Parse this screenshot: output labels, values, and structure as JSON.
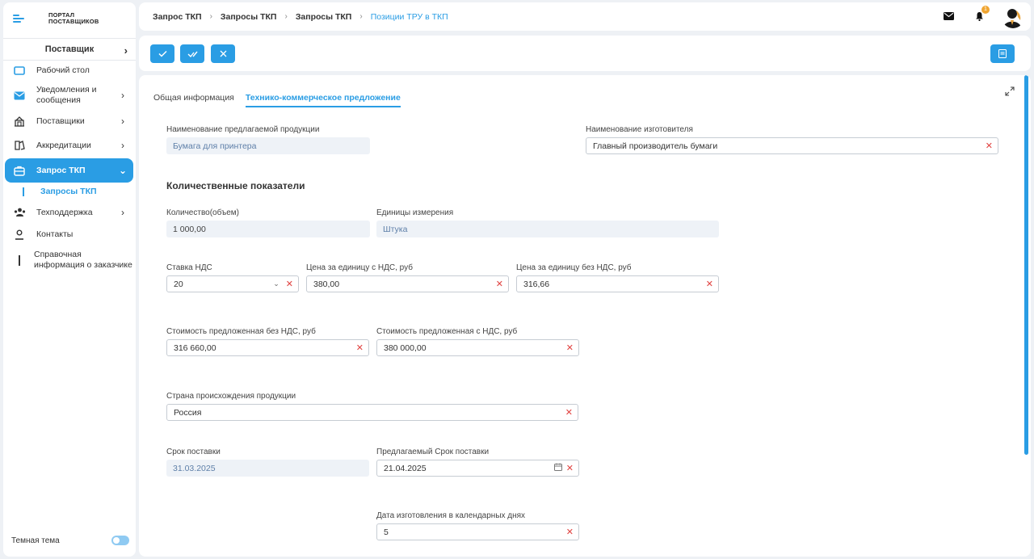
{
  "sidebar": {
    "logo": {
      "line1": "ПОРТАЛ",
      "line2": "ПОСТАВЩИКОВ"
    },
    "role": "Поставщик",
    "items": [
      {
        "label": "Рабочий стол"
      },
      {
        "label": "Уведомления и сообщения"
      },
      {
        "label": "Поставщики"
      },
      {
        "label": "Аккредитации"
      },
      {
        "label": "Запрос ТКП"
      },
      {
        "label": "Техподдержка"
      },
      {
        "label": "Контакты"
      },
      {
        "label": "Справочная информация о заказчике"
      }
    ],
    "subitem": "Запросы ТКП",
    "theme_label": "Темная тема"
  },
  "header": {
    "breadcrumbs": [
      "Запрос ТКП",
      "Запросы ТКП",
      "Запросы ТКП",
      "Позиции ТРУ в ТКП"
    ],
    "notifications_count": "1"
  },
  "tabs": [
    "Общая информация",
    "Технико-коммерческое предложение"
  ],
  "form": {
    "product_name": {
      "label": "Наименование предлагаемой продукции",
      "value": "Бумага для принтера"
    },
    "manufacturer": {
      "label": "Наименование изготовителя",
      "value": "Главный производитель бумаги"
    },
    "section_title": "Количественные показатели",
    "quantity": {
      "label": "Количество(объем)",
      "value": "1 000,00"
    },
    "unit": {
      "label": "Единицы измерения",
      "value": "Штука"
    },
    "vat_rate": {
      "label": "Ставка НДС",
      "value": "20"
    },
    "unit_price_vat": {
      "label": "Цена за единицу с НДС, руб",
      "value": "380,00"
    },
    "unit_price_no_vat": {
      "label": "Цена за единицу без НДС, руб",
      "value": "316,66"
    },
    "cost_no_vat": {
      "label": "Стоимость предложенная без НДС, руб",
      "value": "316 660,00"
    },
    "cost_vat": {
      "label": "Стоимость предложенная с НДС, руб",
      "value": "380 000,00"
    },
    "country": {
      "label": "Страна происхождения продукции",
      "value": "Россия"
    },
    "delivery_term": {
      "label": "Срок поставки",
      "value": "31.03.2025"
    },
    "proposed_delivery": {
      "label": "Предлагаемый Срок поставки",
      "value": "21.04.2025"
    },
    "manufacture_days": {
      "label": "Дата изготовления в календарных днях",
      "value": "5"
    }
  },
  "colors": {
    "accent": "#2a9de4",
    "clear": "#e0413f",
    "badge": "#f0a531"
  }
}
